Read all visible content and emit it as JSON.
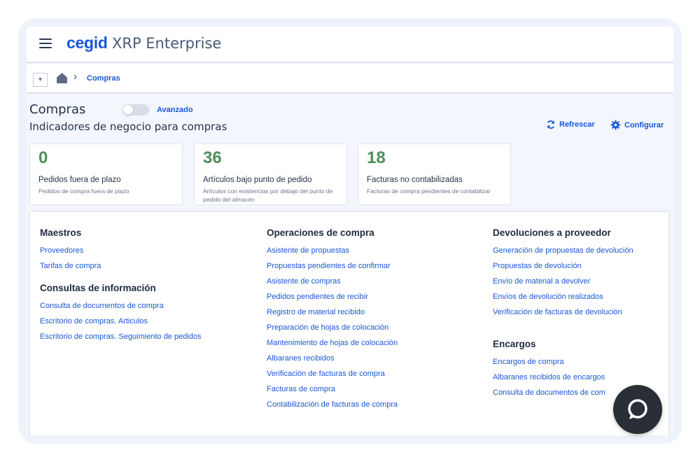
{
  "header": {
    "brand_logo": "cegid",
    "product_name": "XRP Enterprise"
  },
  "breadcrumb": {
    "current": "Compras"
  },
  "page": {
    "title": "Compras",
    "toggle_label": "Avanzado",
    "toggle_on": false,
    "subtitle": "Indicadores de negocio para compras",
    "refresh_label": "Refrescar",
    "configure_label": "Configurar"
  },
  "kpis": [
    {
      "value": "0",
      "title": "Pedidos fuera de plazo",
      "description": "Pedidos de compra fuera de plazo"
    },
    {
      "value": "36",
      "title": "Artículos bajo punto de pedido",
      "description": "Artículos con existencias por debajo del punto de pedido del almacén"
    },
    {
      "value": "18",
      "title": "Facturas no contabilizadas",
      "description": "Facturas de compra pendientes de contabilizar"
    }
  ],
  "menu": {
    "maestros": {
      "title": "Maestros",
      "links": [
        "Proveedores",
        "Tarifas de compra"
      ]
    },
    "consultas": {
      "title": "Consultas de información",
      "links": [
        "Consulta de documentos de compra",
        "Escritorio de compras. Articulos",
        "Escritorio de compras. Seguimiento de pedidos"
      ]
    },
    "operaciones": {
      "title": "Operaciones de compra",
      "links": [
        "Asistente de propuestas",
        "Propuestas pendientes de confirmar",
        "Asistente de compras",
        "Pedidos pendientes de recibir",
        "Registro de material recibido",
        "Preparación de hojas de colocación",
        "Mantenimiento de hojas de colocación",
        "Albaranes recibidos",
        "Verificación de facturas de compra",
        "Facturas de compra",
        "Contabilización de facturas de compra"
      ]
    },
    "devoluciones": {
      "title": "Devoluciones a proveedor",
      "links": [
        "Generación de propuestas de devolución",
        "Propuestas de devolución",
        "Envío de material a devolver",
        "Envíos de devolución realizados",
        "Verificación de facturas de devolución"
      ]
    },
    "encargos": {
      "title": "Encargos",
      "links": [
        "Encargos de compra",
        "Albaranes recibidos de encargos",
        "Consulta de documentos de com"
      ]
    }
  },
  "colors": {
    "accent": "#1a57d6",
    "kpi_value": "#4e8f5a",
    "heading": "#1e2a40",
    "background": "#f3f6fc"
  },
  "icons": [
    "menu-icon",
    "home-icon",
    "chevron-right-icon",
    "refresh-icon",
    "gear-icon",
    "chat-icon",
    "caret-down-icon"
  ]
}
